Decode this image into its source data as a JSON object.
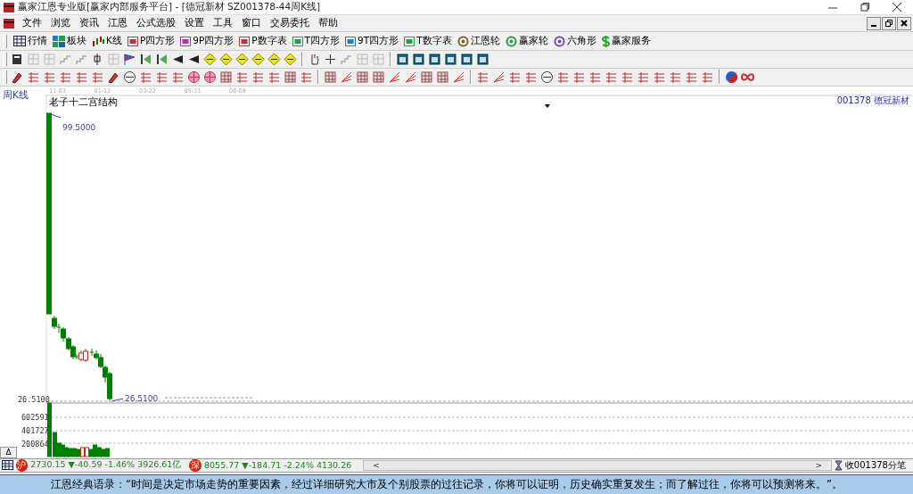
{
  "window": {
    "title": "赢家江恩专业版[赢家内部服务平台] - [德冠新材  SZ001378-44周K线]"
  },
  "menu": [
    "文件",
    "浏览",
    "资讯",
    "江恩",
    "公式选股",
    "设置",
    "工具",
    "窗口",
    "交易委托",
    "帮助"
  ],
  "toolbar": [
    {
      "label": "行情",
      "kind": "grid"
    },
    {
      "label": "板块",
      "kind": "tiles"
    },
    {
      "label": "K线",
      "kind": "candles"
    },
    {
      "label": "P四方形",
      "kind": "box",
      "color": "#c03030"
    },
    {
      "label": "9P四方形",
      "kind": "box",
      "color": "#b030b0"
    },
    {
      "label": "P数字表",
      "kind": "box",
      "color": "#c03030"
    },
    {
      "label": "T四方形",
      "kind": "box",
      "color": "#20a040"
    },
    {
      "label": "9T四方形",
      "kind": "box",
      "color": "#2080c0"
    },
    {
      "label": "T数字表",
      "kind": "box",
      "color": "#20a040"
    },
    {
      "label": "江恩轮",
      "kind": "target",
      "color": "#806020"
    },
    {
      "label": "赢家轮",
      "kind": "target",
      "color": "#20a040"
    },
    {
      "label": "六角形",
      "kind": "target",
      "color": "#8040c0"
    },
    {
      "label": "赢家服务",
      "kind": "dollar"
    }
  ],
  "chart": {
    "period": "周K线",
    "dates": [
      "11-03",
      "01-12",
      "03-22",
      "05-31",
      "08-09"
    ],
    "stock_code": "001378",
    "stock_name": "德冠新材",
    "indicator": "老子十二宫结构",
    "high_label": "99.5000",
    "low_label": "26.5100",
    "price_axis_label": "26.5100",
    "volume_labels": [
      "602591",
      "401727",
      "200864"
    ],
    "collapse_button": "Δ"
  },
  "status_bar": {
    "indices": [
      {
        "market": "沪",
        "text": "2730.15 ▼-40.59 -1.46% 3926.61亿"
      },
      {
        "market": "深",
        "text": "8055.77 ▼-184.71 -2.24% 4130.26"
      }
    ],
    "scroll_left": "<",
    "scroll_right": ">",
    "right_text": "收001378分笔"
  },
  "ticker": "江恩经典语录：“时间是决定市场走势的重要因素，经过详细研究大市及个别股票的过往记录，你将可以证明，历史确实重复发生；而了解过往，你将可以预测将来。”。"
}
